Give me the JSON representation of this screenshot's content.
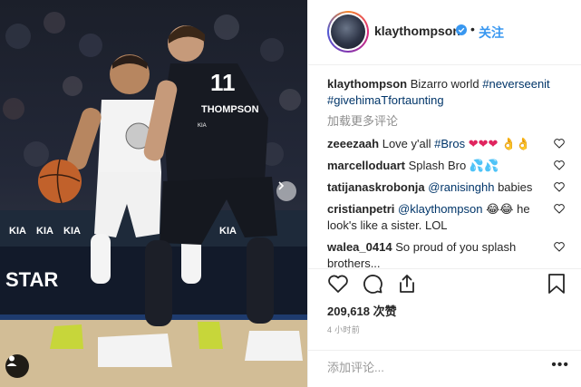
{
  "post": {
    "username": "klaythompson",
    "follow_label": "关注",
    "header_separator": "•"
  },
  "caption": {
    "username": "klaythompson",
    "text": "Bizarro world",
    "hashtag1": "#neverseenit",
    "hashtag2": "#givehimaTfortaunting"
  },
  "load_more": "加载更多评论",
  "comments": [
    {
      "username": "zeeezaah",
      "pre": "Love y'all",
      "tag": "#Bros",
      "emoji_hearts": "❤❤❤",
      "emoji_hands": "👌👌"
    },
    {
      "username": "marcelloduart",
      "pre": "Splash Bro",
      "emoji": "💦💦"
    },
    {
      "username": "tatijanaskrobonja",
      "mention": "@ranisinghh",
      "post": "babies"
    },
    {
      "username": "cristianpetri",
      "mention": "@klaythompson",
      "emoji": "😂😂",
      "post": "he look's like a sister. LOL"
    },
    {
      "username": "walea_0414",
      "pre": "So proud of you splash brothers..."
    }
  ],
  "likes": {
    "count": "209,618",
    "label": "次赞"
  },
  "timestamp": "4 小时前",
  "add_comment_placeholder": "添加评论...",
  "options_label": "•••",
  "photo": {
    "jersey_number": "11",
    "jersey_name": "THOMPSON",
    "jersey_brand": "KIA",
    "banner_text": "STAR",
    "kia_logos": [
      "KIA",
      "KIA",
      "KIA",
      "KIA"
    ]
  },
  "icons": {
    "verified": "verified-badge-icon",
    "heart": "heart-icon",
    "comment": "comment-icon",
    "share": "share-icon",
    "save": "bookmark-icon",
    "user": "user-tag-icon",
    "next": "chevron-right-icon"
  },
  "colors": {
    "follow": "#3897f0",
    "hashtag": "#003569",
    "muted": "#8e8e8e",
    "heart_red": "#e0245e"
  }
}
